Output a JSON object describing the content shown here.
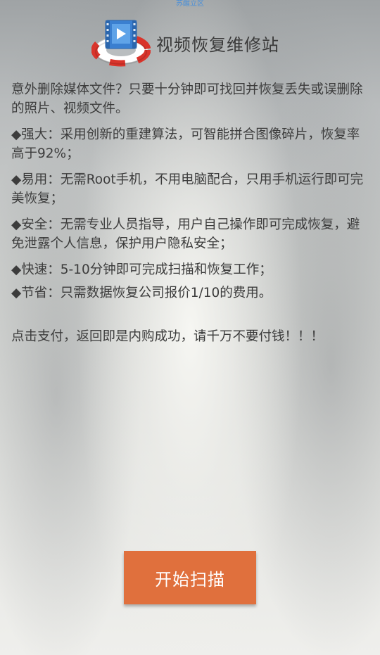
{
  "status_bar": {
    "label": "苏醒立区"
  },
  "header": {
    "icon": "video-lifebuoy-icon",
    "title": "视频恢复维修站"
  },
  "description": {
    "intro": "意外删除媒体文件？只要十分钟即可找回并恢复丢失或误删除的照片、视频文件。",
    "features": [
      "◆强大：采用创新的重建算法，可智能拼合图像碎片，恢复率高于92%；",
      "◆易用：无需Root手机，不用电脑配合，只用手机运行即可完美恢复；",
      "◆安全：无需专业人员指导，用户自己操作即可完成恢复，避免泄露个人信息，保护用户隐私安全；",
      "◆快速：5-10分钟即可完成扫描和恢复工作；",
      "◆节省：只需数据恢复公司报价1/10的费用。"
    ]
  },
  "notice": {
    "text": "点击支付，返回即是内购成功，请千万不要付钱！！！"
  },
  "actions": {
    "start_scan_label": "开始扫描"
  },
  "colors": {
    "button_bg": "#e0703d",
    "button_text": "#ffffff",
    "body_text": "#3c3c3c",
    "status_label": "#4a8fd8"
  }
}
